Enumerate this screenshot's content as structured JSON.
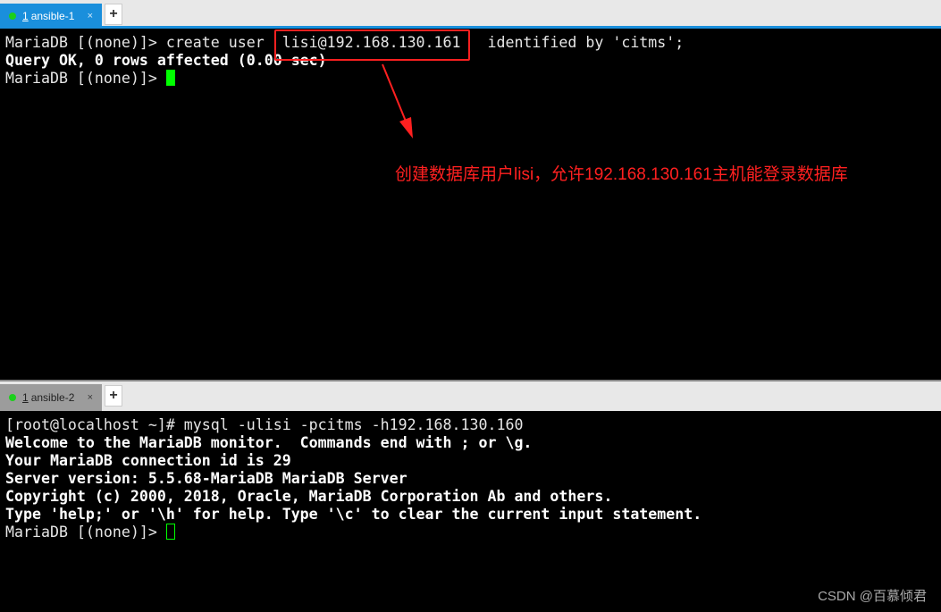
{
  "top_pane": {
    "tab": {
      "number": "1",
      "label": "ansible-1",
      "close": "×"
    },
    "new_tab": "+",
    "lines": [
      {
        "text": "MariaDB [(none)]> create user  lisi@192.168.130.161   identified by 'citms';",
        "bold": false
      },
      {
        "text": "Query OK, 0 rows affected (0.00 sec)",
        "bold": true
      },
      {
        "text": "",
        "bold": false
      },
      {
        "text": "MariaDB [(none)]> ",
        "bold": false
      }
    ]
  },
  "annotation": {
    "text": "创建数据库用户lisi，允许192.168.130.161主机能登录数据库",
    "color": "#ff2020"
  },
  "bottom_pane": {
    "tab": {
      "number": "1",
      "label": "ansible-2",
      "close": "×"
    },
    "new_tab": "+",
    "lines": [
      {
        "text": "[root@localhost ~]# mysql -ulisi -pcitms -h192.168.130.160",
        "bold": false
      },
      {
        "text": "Welcome to the MariaDB monitor.  Commands end with ; or \\g.",
        "bold": true
      },
      {
        "text": "Your MariaDB connection id is 29",
        "bold": true
      },
      {
        "text": "Server version: 5.5.68-MariaDB MariaDB Server",
        "bold": true
      },
      {
        "text": "",
        "bold": false
      },
      {
        "text": "Copyright (c) 2000, 2018, Oracle, MariaDB Corporation Ab and others.",
        "bold": true
      },
      {
        "text": "",
        "bold": false
      },
      {
        "text": "Type 'help;' or '\\h' for help. Type '\\c' to clear the current input statement.",
        "bold": true
      },
      {
        "text": "",
        "bold": false
      },
      {
        "text": "MariaDB [(none)]> ",
        "bold": false
      }
    ]
  },
  "watermark": "CSDN @百慕倾君",
  "colors": {
    "accent": "#1a8fdc",
    "cursor": "#00ff00",
    "annotation": "#ff2020"
  }
}
